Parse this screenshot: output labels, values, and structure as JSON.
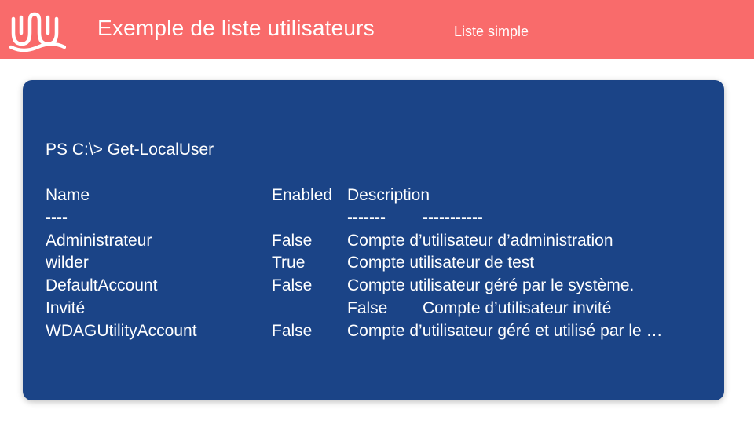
{
  "header": {
    "title": "Exemple de liste utilisateurs",
    "subtitle": "Liste simple",
    "logo_icon": "wave-logo-icon",
    "bg_color": "#f96b6b"
  },
  "terminal": {
    "bg_color": "#1b4487",
    "command": "PS C:\\> Get-LocalUser",
    "columns": {
      "name": "Name",
      "enabled": "Enabled",
      "description": "Description"
    },
    "separators": {
      "name": "----",
      "enabled": "-------",
      "description": "-----------"
    },
    "rows": [
      {
        "name": "Administrateur",
        "enabled": "False",
        "description": "Compte d’utilisateur d’administration"
      },
      {
        "name": "wilder",
        "enabled": "True",
        "description": "Compte utilisateur de test"
      },
      {
        "name": "DefaultAccount",
        "enabled": "False",
        "description": "Compte utilisateur géré par le système."
      },
      {
        "name": "Invité",
        "enabled": "False",
        "description": "Compte d’utilisateur invité"
      },
      {
        "name": "WDAGUtilityAccount",
        "enabled": "False",
        "description": "Compte d’utilisateur géré et utilisé par le …"
      }
    ]
  }
}
